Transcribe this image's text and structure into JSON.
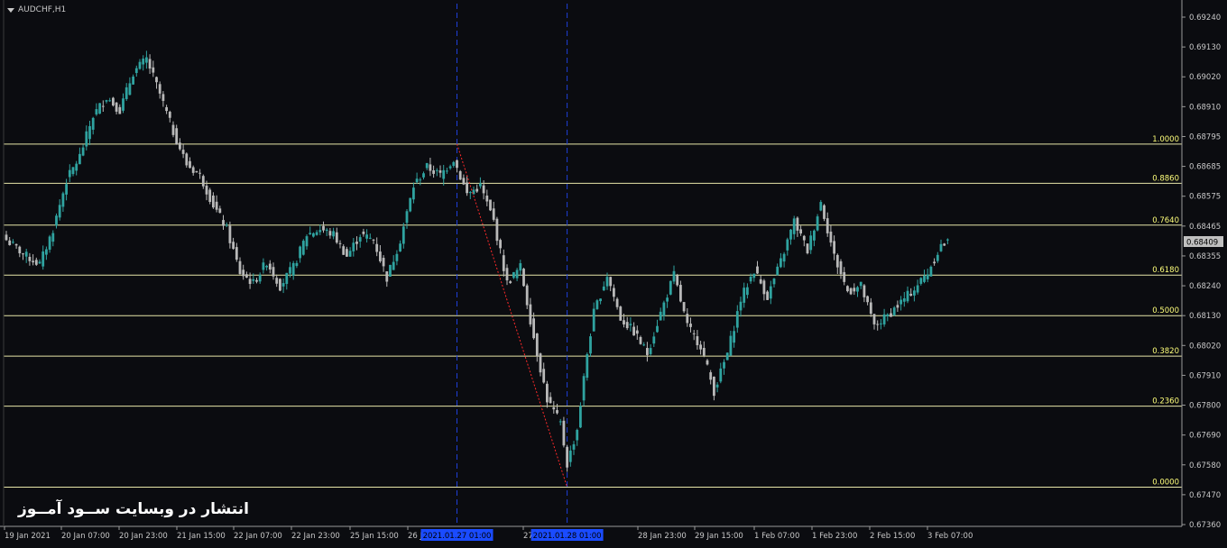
{
  "window": {
    "symbol_label": "AUDCHF,H1",
    "menu_icon": "dropdown-triangle-icon"
  },
  "watermark": "انتشار در وبسایت ســود آمــوز",
  "colors": {
    "background": "#0b0c10",
    "bull_candle": "#2fa3a0",
    "bear_candle": "#b9b9b9",
    "fib_line": "#e8e6a8",
    "fib_label": "#ffff7a",
    "fib_trend": "#ff2a2a",
    "vline": "#1f3fd9",
    "axis_text": "#c8c8c8",
    "current_price_bg": "#c0c0c0"
  },
  "chart_data": {
    "type": "candlestick",
    "title": "AUDCHF,H1",
    "ylim": [
      0.6736,
      0.69295
    ],
    "price_ticks": [
      "0.69240",
      "0.69130",
      "0.69020",
      "0.68910",
      "0.68795",
      "0.68685",
      "0.68575",
      "0.68465",
      "0.68355",
      "0.68240",
      "0.68130",
      "0.68020",
      "0.67910",
      "0.67800",
      "0.67690",
      "0.67580",
      "0.67470",
      "0.67360"
    ],
    "current_price": "0.68409",
    "time_labels": [
      "19 Jan 2021",
      "20 Jan 07:00",
      "20 Jan 23:00",
      "21 Jan 15:00",
      "22 Jan 07:00",
      "22 Jan 23:00",
      "25 Jan 15:00",
      "26 Jan 07:00",
      "27 Jan 15:00",
      "28 Jan 23:00",
      "29 Jan 15:00",
      "1 Feb 07:00",
      "1 Feb 23:00",
      "2 Feb 15:00",
      "3 Feb 07:00"
    ],
    "highlighted_time_labels": [
      "2021.01.27 01:00",
      "2021.01.28 01:00"
    ],
    "fibonacci": {
      "levels": [
        {
          "label": "1.0000",
          "price": 0.68775
        },
        {
          "label": "0.8860",
          "price": 0.6863
        },
        {
          "label": "0.7640",
          "price": 0.68475
        },
        {
          "label": "0.6180",
          "price": 0.6829
        },
        {
          "label": "0.5000",
          "price": 0.6814
        },
        {
          "label": "0.3820",
          "price": 0.6799
        },
        {
          "label": "0.2360",
          "price": 0.67805
        },
        {
          "label": "0.0000",
          "price": 0.67505
        }
      ],
      "trend_from": {
        "bar": 135,
        "price": 0.68775
      },
      "trend_to": {
        "bar": 168,
        "price": 0.67505
      }
    },
    "vertical_markers": [
      135,
      168
    ],
    "candles_anchor_closes": [
      [
        0,
        0.6842
      ],
      [
        6,
        0.6836
      ],
      [
        10,
        0.6833
      ],
      [
        14,
        0.6846
      ],
      [
        18,
        0.6864
      ],
      [
        22,
        0.6873
      ],
      [
        26,
        0.6888
      ],
      [
        30,
        0.6895
      ],
      [
        34,
        0.689
      ],
      [
        38,
        0.6904
      ],
      [
        42,
        0.6909
      ],
      [
        46,
        0.6896
      ],
      [
        50,
        0.6882
      ],
      [
        54,
        0.687
      ],
      [
        58,
        0.6866
      ],
      [
        62,
        0.6855
      ],
      [
        66,
        0.6846
      ],
      [
        70,
        0.683
      ],
      [
        74,
        0.6826
      ],
      [
        78,
        0.6834
      ],
      [
        82,
        0.6825
      ],
      [
        86,
        0.6832
      ],
      [
        90,
        0.6844
      ],
      [
        94,
        0.6846
      ],
      [
        98,
        0.6844
      ],
      [
        102,
        0.6836
      ],
      [
        106,
        0.6844
      ],
      [
        110,
        0.6842
      ],
      [
        114,
        0.6828
      ],
      [
        118,
        0.6842
      ],
      [
        122,
        0.6862
      ],
      [
        126,
        0.6869
      ],
      [
        130,
        0.6866
      ],
      [
        134,
        0.6872
      ],
      [
        138,
        0.6859
      ],
      [
        142,
        0.6862
      ],
      [
        146,
        0.6849
      ],
      [
        150,
        0.6826
      ],
      [
        154,
        0.6832
      ],
      [
        158,
        0.6806
      ],
      [
        162,
        0.6783
      ],
      [
        166,
        0.6774
      ],
      [
        168,
        0.6759
      ],
      [
        171,
        0.6772
      ],
      [
        174,
        0.68
      ],
      [
        176,
        0.6815
      ],
      [
        180,
        0.6829
      ],
      [
        184,
        0.6813
      ],
      [
        188,
        0.6808
      ],
      [
        192,
        0.68
      ],
      [
        196,
        0.6815
      ],
      [
        200,
        0.6829
      ],
      [
        204,
        0.681
      ],
      [
        208,
        0.6803
      ],
      [
        212,
        0.6786
      ],
      [
        216,
        0.68
      ],
      [
        220,
        0.682
      ],
      [
        224,
        0.6831
      ],
      [
        228,
        0.6821
      ],
      [
        232,
        0.6834
      ],
      [
        236,
        0.6849
      ],
      [
        240,
        0.6838
      ],
      [
        244,
        0.6856
      ],
      [
        248,
        0.6836
      ],
      [
        252,
        0.6823
      ],
      [
        256,
        0.6825
      ],
      [
        260,
        0.681
      ],
      [
        264,
        0.6814
      ],
      [
        268,
        0.6819
      ],
      [
        272,
        0.6824
      ],
      [
        276,
        0.683
      ],
      [
        280,
        0.684
      ],
      [
        282,
        0.68409
      ]
    ]
  }
}
